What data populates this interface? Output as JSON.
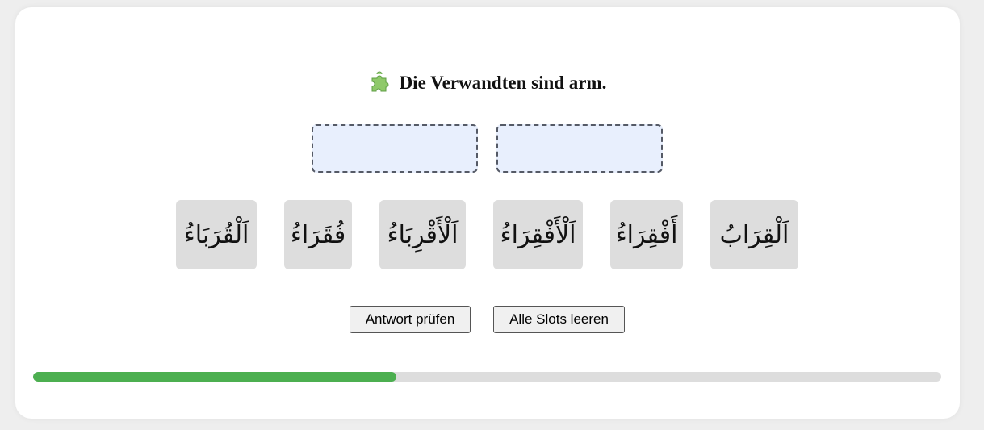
{
  "quiz": {
    "icon": "puzzle-piece-icon",
    "prompt": "Die Verwandten sind arm."
  },
  "slots": [
    {
      "value": ""
    },
    {
      "value": ""
    }
  ],
  "tiles": [
    {
      "label": "اَلْقُرَبَاءُ"
    },
    {
      "label": "فُقَرَاءُ"
    },
    {
      "label": "اَلْأَقْرِبَاءُ"
    },
    {
      "label": "اَلْأَفْقِرَاءُ"
    },
    {
      "label": "أَفْقِرَاءُ"
    },
    {
      "label": "اَلْقِرَابُ"
    }
  ],
  "buttons": {
    "check": "Antwort prüfen",
    "clear": "Alle Slots leeren"
  },
  "progress": {
    "fraction": 0.4
  },
  "colors": {
    "slot_bg": "#e8effd",
    "tile_bg": "#dddddd",
    "progress_fill": "#4caf50",
    "progress_track": "#dddddd"
  }
}
